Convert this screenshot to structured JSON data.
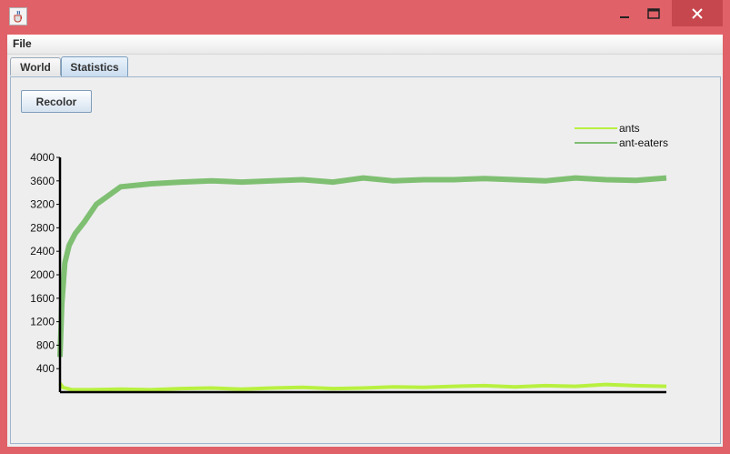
{
  "window": {
    "icon": "java-cup-icon",
    "controls": [
      "minimize-icon",
      "maximize-icon",
      "close-icon"
    ],
    "frame_color": "#e06168"
  },
  "menubar": {
    "items": [
      "File"
    ]
  },
  "tabs": [
    {
      "label": "World",
      "selected": false
    },
    {
      "label": "Statistics",
      "selected": true
    }
  ],
  "toolbar": {
    "recolor_label": "Recolor"
  },
  "chart_data": {
    "type": "line",
    "title": "",
    "xlabel": "",
    "ylabel": "",
    "ylim": [
      0,
      4000
    ],
    "yticks": [
      400,
      800,
      1200,
      1600,
      2000,
      2400,
      2800,
      3200,
      3600,
      4000
    ],
    "x_range": [
      0,
      1000
    ],
    "grid": false,
    "legend_position": "top-right",
    "series": [
      {
        "name": "ants",
        "color": "#b8f040",
        "x": [
          0,
          5,
          20,
          50,
          100,
          150,
          200,
          250,
          300,
          350,
          400,
          450,
          500,
          550,
          600,
          650,
          700,
          750,
          800,
          850,
          900,
          950,
          1000
        ],
        "values": [
          150,
          80,
          40,
          40,
          50,
          40,
          60,
          70,
          50,
          70,
          80,
          60,
          70,
          90,
          80,
          100,
          110,
          90,
          110,
          100,
          130,
          110,
          100
        ]
      },
      {
        "name": "ant-eaters",
        "color": "#7fbf72",
        "x": [
          0,
          3,
          8,
          15,
          25,
          40,
          60,
          80,
          100,
          150,
          200,
          250,
          300,
          350,
          400,
          450,
          500,
          550,
          600,
          650,
          700,
          750,
          800,
          850,
          900,
          950,
          1000
        ],
        "values": [
          600,
          1500,
          2200,
          2500,
          2700,
          2900,
          3200,
          3350,
          3500,
          3550,
          3580,
          3600,
          3580,
          3600,
          3620,
          3580,
          3650,
          3600,
          3620,
          3620,
          3640,
          3620,
          3600,
          3650,
          3620,
          3610,
          3650
        ]
      }
    ]
  }
}
